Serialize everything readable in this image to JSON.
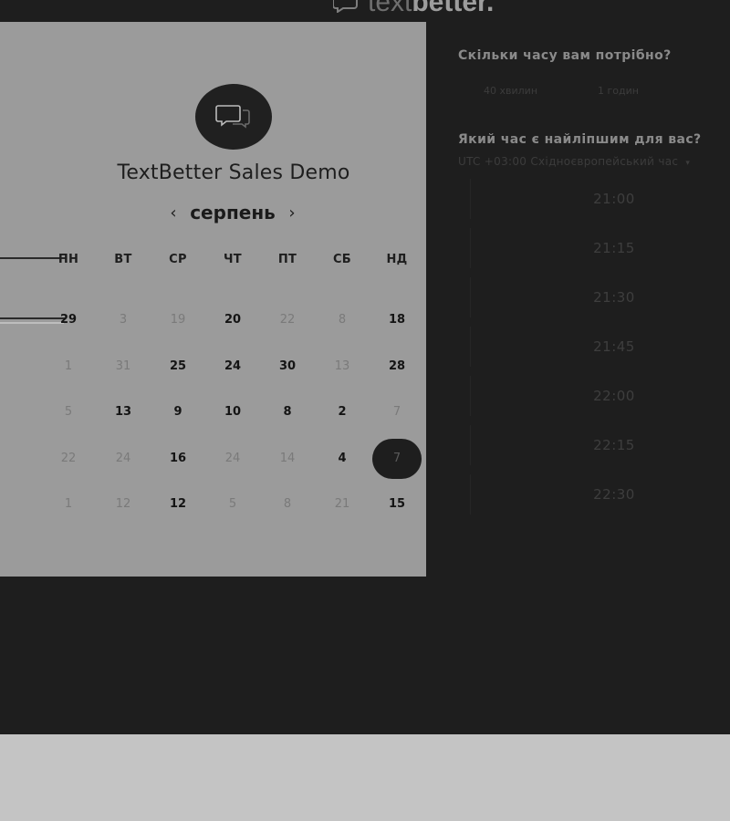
{
  "brand": {
    "logo_left": "text",
    "logo_right": "better."
  },
  "calendar": {
    "event_title": "TextBetter Sales Demo",
    "month": "серпень",
    "prev_icon": "‹",
    "next_icon": "›",
    "weekdays": [
      "ПН",
      "ВТ",
      "СР",
      "ЧТ",
      "ПТ",
      "СБ",
      "НД"
    ],
    "weeks": [
      [
        {
          "d": "29",
          "a": true
        },
        {
          "d": "3",
          "a": false
        },
        {
          "d": "19",
          "a": false
        },
        {
          "d": "20",
          "a": true
        },
        {
          "d": "22",
          "a": false
        },
        {
          "d": "8",
          "a": false
        },
        {
          "d": "18",
          "a": true
        }
      ],
      [
        {
          "d": "1",
          "a": false
        },
        {
          "d": "31",
          "a": false
        },
        {
          "d": "25",
          "a": true
        },
        {
          "d": "24",
          "a": true
        },
        {
          "d": "30",
          "a": true
        },
        {
          "d": "13",
          "a": false
        },
        {
          "d": "28",
          "a": true
        }
      ],
      [
        {
          "d": "5",
          "a": false
        },
        {
          "d": "13",
          "a": true
        },
        {
          "d": "9",
          "a": true
        },
        {
          "d": "10",
          "a": true
        },
        {
          "d": "8",
          "a": true
        },
        {
          "d": "2",
          "a": true
        },
        {
          "d": "7",
          "a": false
        }
      ],
      [
        {
          "d": "22",
          "a": false
        },
        {
          "d": "24",
          "a": false
        },
        {
          "d": "16",
          "a": true
        },
        {
          "d": "24",
          "a": false
        },
        {
          "d": "14",
          "a": false
        },
        {
          "d": "4",
          "a": true
        },
        {
          "d": "7",
          "a": false,
          "selected": true
        }
      ],
      [
        {
          "d": "1",
          "a": false
        },
        {
          "d": "12",
          "a": false
        },
        {
          "d": "12",
          "a": true
        },
        {
          "d": "5",
          "a": false
        },
        {
          "d": "8",
          "a": false
        },
        {
          "d": "21",
          "a": false
        },
        {
          "d": "15",
          "a": true
        }
      ]
    ]
  },
  "booking": {
    "duration_question": "Скільки часу вам потрібно?",
    "durations": [
      "40 хвилин",
      "1 годин"
    ],
    "time_question": "Який час є найліпшим для вас?",
    "timezone": "UTC +03:00 Східноєвропейський час",
    "timezone_caret": "▾",
    "slots": [
      "21:00",
      "21:15",
      "21:30",
      "21:45",
      "22:00",
      "22:15",
      "22:30"
    ]
  },
  "icons": {
    "avatar": "chat-bubbles-icon",
    "logo": "chat-bubble-logo-icon"
  }
}
